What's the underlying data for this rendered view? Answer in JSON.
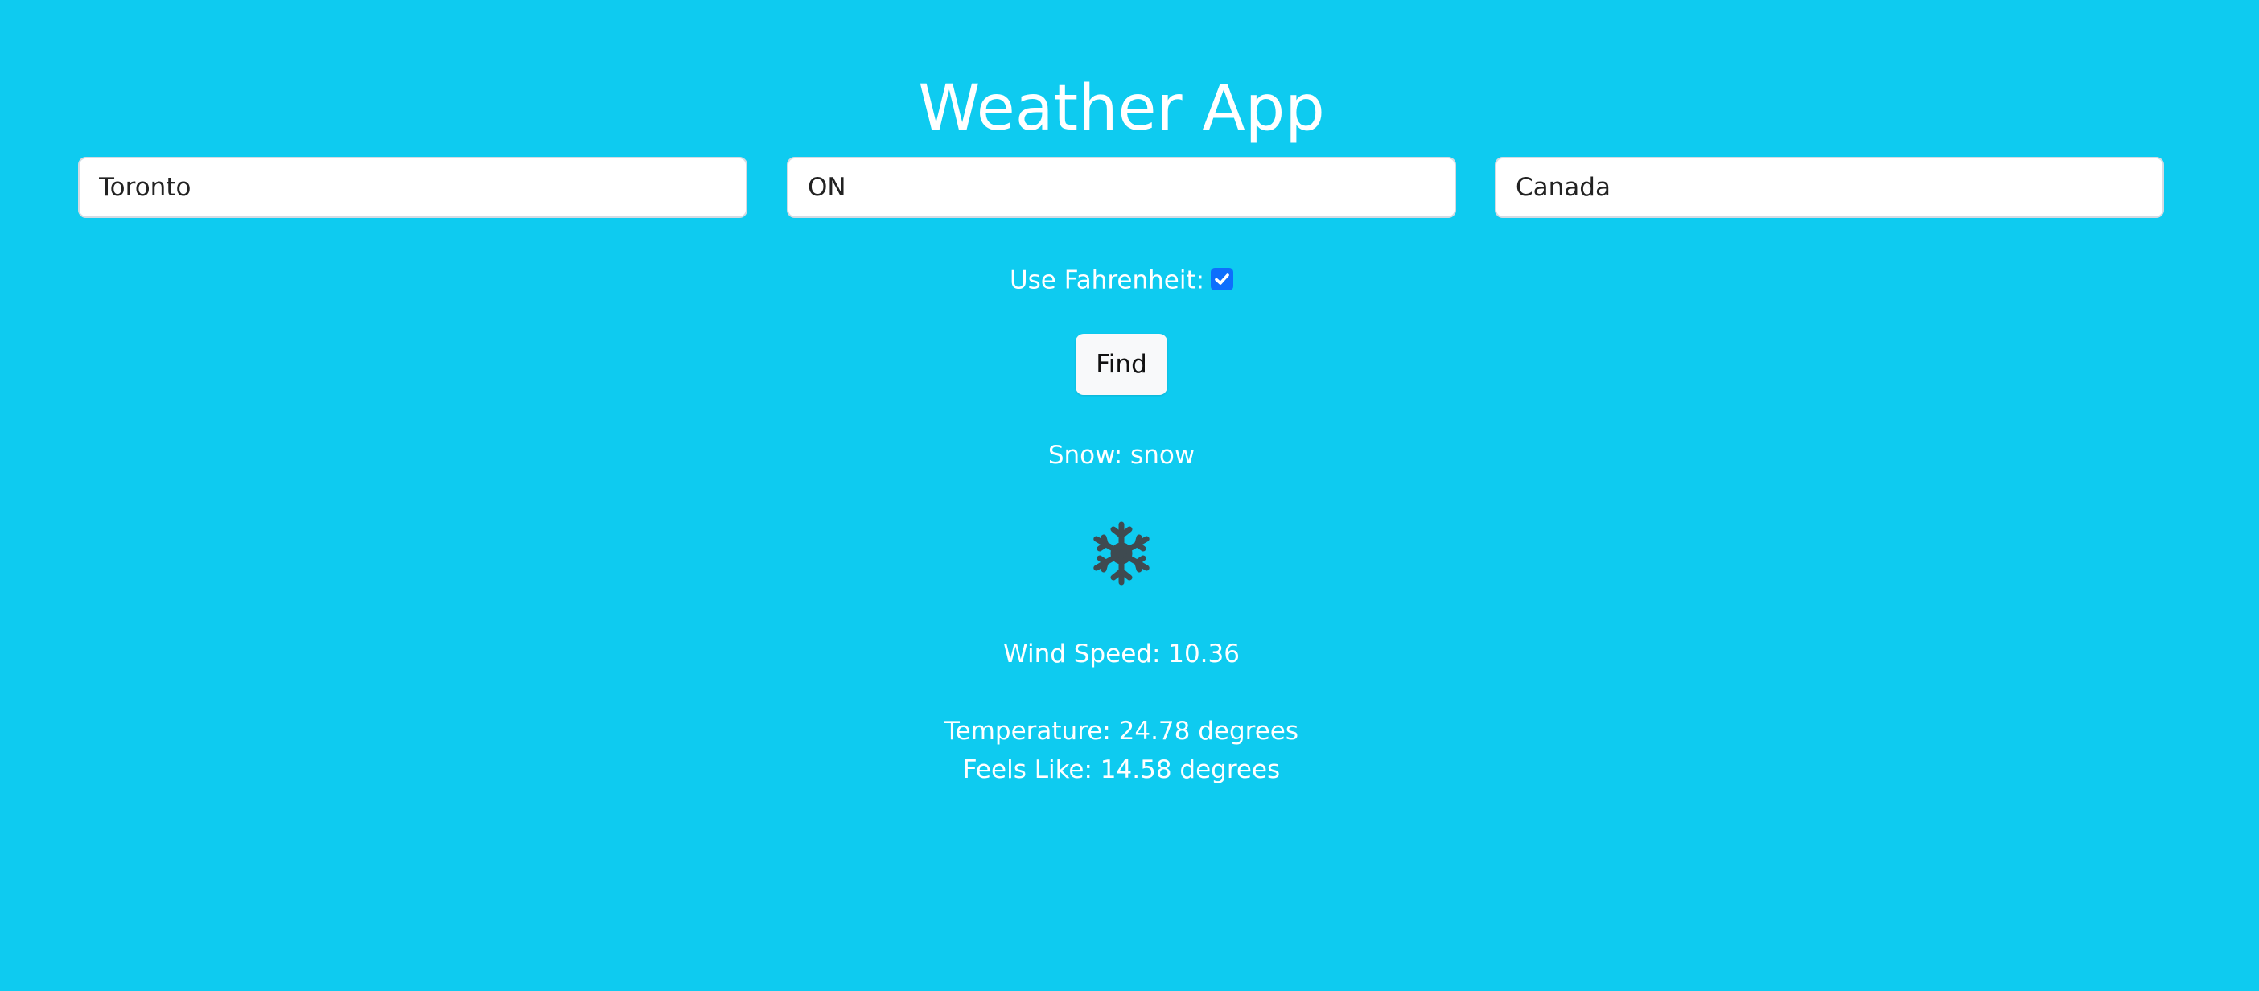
{
  "app": {
    "title": "Weather App"
  },
  "search": {
    "city_value": "Toronto",
    "state_value": "ON",
    "country_value": "Canada"
  },
  "units": {
    "label": "Use Fahrenheit:",
    "fahrenheit_checked": true
  },
  "actions": {
    "find_label": "Find"
  },
  "weather": {
    "condition_text": "Snow: snow",
    "icon": "snowflake-icon",
    "wind_text": "Wind Speed: 10.36",
    "temperature_text": "Temperature: 24.78 degrees",
    "feels_like_text": "Feels Like: 14.58 degrees"
  },
  "colors": {
    "background": "#0ecbf0",
    "text": "#ffffff",
    "checkbox": "#0d6efd",
    "icon": "#3f4a50",
    "button_bg": "#f8f9fa"
  }
}
